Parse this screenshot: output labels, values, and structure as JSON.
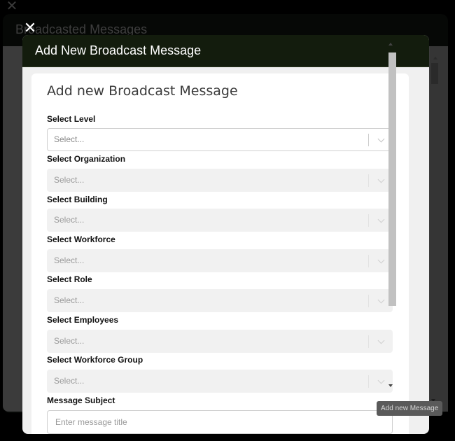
{
  "background": {
    "close_icon": "close-icon",
    "modal_title": "Broadcasted Messages"
  },
  "modal": {
    "close_icon": "close-icon",
    "header_title": "Add New Broadcast Message",
    "form_title": "Add new Broadcast Message",
    "fields": [
      {
        "label": "Select Level",
        "placeholder": "Select...",
        "type": "select",
        "enabled": true
      },
      {
        "label": "Select Organization",
        "placeholder": "Select...",
        "type": "select",
        "enabled": false
      },
      {
        "label": "Select Building",
        "placeholder": "Select...",
        "type": "select",
        "enabled": false
      },
      {
        "label": "Select Workforce",
        "placeholder": "Select...",
        "type": "select",
        "enabled": false
      },
      {
        "label": "Select Role",
        "placeholder": "Select...",
        "type": "select",
        "enabled": false
      },
      {
        "label": "Select Employees",
        "placeholder": "Select...",
        "type": "select",
        "enabled": false
      },
      {
        "label": "Select Workforce Group",
        "placeholder": "Select...",
        "type": "select",
        "enabled": false
      },
      {
        "label": "Message Subject",
        "placeholder": "Enter message title",
        "type": "text",
        "value": ""
      }
    ]
  },
  "tooltip": {
    "text": "Add new Message"
  },
  "colors": {
    "header_bg": "#131c0d",
    "page_bg": "#000000",
    "disabled_field_bg": "#f1f1f1"
  }
}
